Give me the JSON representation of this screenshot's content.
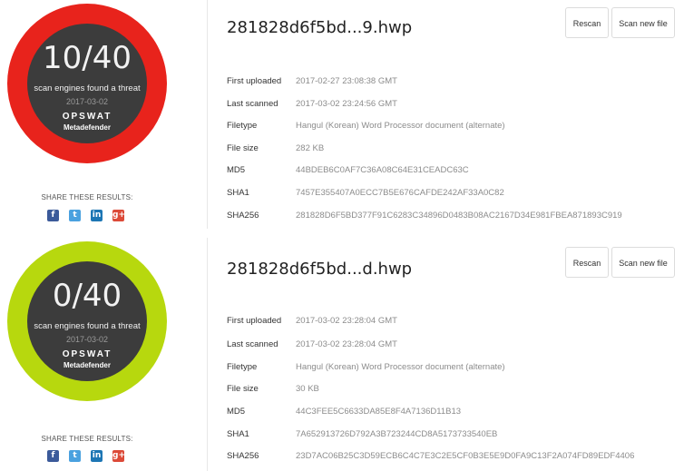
{
  "results": [
    {
      "score": "10/40",
      "caption": "scan engines found a threat",
      "date": "2017-03-02",
      "brand": "OPSWAT",
      "product": "Metadefender",
      "ring_color": "#e8231c",
      "share_label": "SHARE THESE RESULTS:",
      "file_name": "281828d6f5bd...9.hwp",
      "rescan_label": "Rescan",
      "scan_new_label": "Scan new file",
      "details": [
        {
          "label": "First uploaded",
          "value": "2017-02-27 23:08:38 GMT"
        },
        {
          "label": "Last scanned",
          "value": "2017-03-02 23:24:56 GMT"
        },
        {
          "label": "Filetype",
          "value": "Hangul (Korean) Word Processor document (alternate)"
        },
        {
          "label": "File size",
          "value": "282 KB"
        },
        {
          "label": "MD5",
          "value": "44BDEB6C0AF7C36A08C64E31CEADC63C"
        },
        {
          "label": "SHA1",
          "value": "7457E355407A0ECC7B5E676CAFDE242AF33A0C82"
        },
        {
          "label": "SHA256",
          "value": "281828D6F5BD377F91C6283C34896D0483B08AC2167D34E981FBEA871893C919"
        }
      ]
    },
    {
      "score": "0/40",
      "caption": "scan engines found a threat",
      "date": "2017-03-02",
      "brand": "OPSWAT",
      "product": "Metadefender",
      "ring_color": "#b7d80e",
      "share_label": "SHARE THESE RESULTS:",
      "file_name": "281828d6f5bd...d.hwp",
      "rescan_label": "Rescan",
      "scan_new_label": "Scan new file",
      "details": [
        {
          "label": "First uploaded",
          "value": "2017-03-02 23:28:04 GMT"
        },
        {
          "label": "Last scanned",
          "value": "2017-03-02 23:28:04 GMT"
        },
        {
          "label": "Filetype",
          "value": "Hangul (Korean) Word Processor document (alternate)"
        },
        {
          "label": "File size",
          "value": "30 KB"
        },
        {
          "label": "MD5",
          "value": "44C3FEE5C6633DA85E8F4A7136D11B13"
        },
        {
          "label": "SHA1",
          "value": "7A652913726D792A3B723244CD8A5173733540EB"
        },
        {
          "label": "SHA256",
          "value": "23D7AC06B25C3D59ECB6C4C7E3C2E5CF0B3E5E9D0FA9C13F2A074FD89EDF4406"
        }
      ]
    }
  ],
  "icons": {
    "facebook": "facebook-icon",
    "twitter": "twitter-icon",
    "linkedin": "linkedin-icon",
    "googleplus": "google-plus-icon"
  }
}
